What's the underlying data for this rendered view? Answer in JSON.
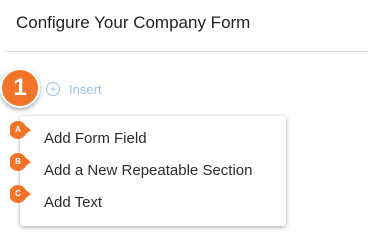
{
  "page": {
    "title": "Configure Your Company Form"
  },
  "step_badge": {
    "number": "1",
    "color": "#f27429"
  },
  "insert": {
    "icon": "plus-circle-icon",
    "label": "Insert",
    "color": "#9bbfdc"
  },
  "menu": {
    "items": [
      {
        "badge": "A",
        "label": "Add Form Field"
      },
      {
        "badge": "B",
        "label": "Add a New Repeatable Section"
      },
      {
        "badge": "C",
        "label": "Add Text"
      }
    ]
  }
}
